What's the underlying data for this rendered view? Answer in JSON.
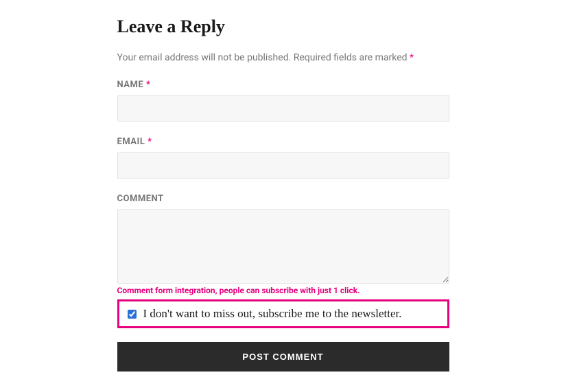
{
  "heading": "Leave a Reply",
  "intro": {
    "text": "Your email address will not be published. Required fields are marked ",
    "marker": "*"
  },
  "fields": {
    "name": {
      "label": "NAME",
      "required_marker": "*",
      "value": ""
    },
    "email": {
      "label": "EMAIL",
      "required_marker": "*",
      "value": ""
    },
    "comment": {
      "label": "COMMENT",
      "value": ""
    }
  },
  "annotation": "Comment form integration, people can subscribe with just 1 click.",
  "subscribe": {
    "checked": true,
    "label": "I don't want to miss out, subscribe me to the newsletter."
  },
  "submit_label": "POST COMMENT"
}
